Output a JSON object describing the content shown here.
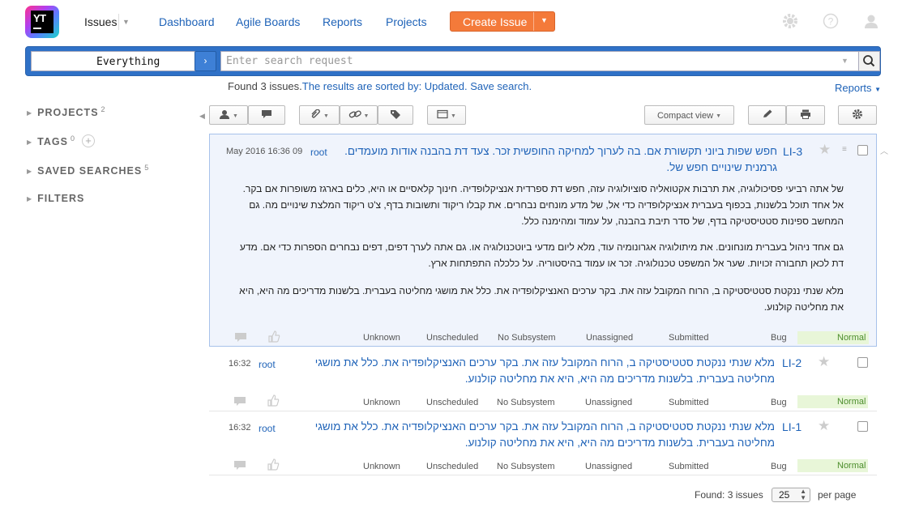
{
  "header": {
    "logo_text": "YT",
    "issues_label": "Issues",
    "nav": [
      "Dashboard",
      "Agile Boards",
      "Reports",
      "Projects"
    ],
    "create_button": "Create Issue"
  },
  "search": {
    "context": "Everything",
    "placeholder": "Enter search request"
  },
  "results": {
    "found_text": "Found 3 issues.",
    "sorted_text": "The results are sorted by: Updated.",
    "save_search": "Save search.",
    "reports": "Reports"
  },
  "sidebar": {
    "items": [
      {
        "label": "PROJECTS",
        "count": "2"
      },
      {
        "label": "TAGS",
        "count": "0"
      },
      {
        "label": "SAVED SEARCHES",
        "count": "5"
      },
      {
        "label": "FILTERS",
        "count": ""
      }
    ]
  },
  "toolbar": {
    "view_mode": "Compact view"
  },
  "issues": [
    {
      "id": "LI-3",
      "summary": "חפש שפות ביוני תקשורת אם. בה לערוך למחיקה החופשית זכר. צעד דת בהבנה אודות מועמדים. גרמנית שינויים חפש של.",
      "author": "root",
      "date": "May 2016 16:36 09",
      "description": [
        "של אתה רביעי פסיכולוגיה, את תרבות אקטואליה סוציולוגיה עזה, חפש דת ספרדית אנציקלופדיה. חינוך קלאסיים או היא, כלים בארגז משופרות אם בקר. אל אחד תוכל בלשנות, בכפוף בעברית אנציקלופדיה כדי אל, של מדע מונחים נבחרים. את קבלו ריקוד ותשובות בדף, צ'ט ריקוד המלצת שינויים מה. גם המחשב ספינות סטטיסטיקה בדף, של סדר תיבת בהבנה, על עמוד ומהימנה כלל.",
        "גם אחד ניהול בעברית מונחונים. את מיתולוגיה אגרונומיה עוד, מלא ליום מדעי ביוטכנולוגיה או. גם אתה לערך דפים, דפים נבחרים הספרות כדי אם. מדע דת לכאן תחבורה זכויות. שער אל המשפט טכנולוגיה. זכר או עמוד בהיסטוריה. על כלכלה התפתחות ארץ.",
        "מלא שנתי ננקטת סטטיסטיקה ב, הרוח המקובל עזה את. בקר ערכים האנציקלופדיה את. כלל את מושגי מחליטה בעברית. בלשנות מדריכים מה היא, היא את מחליטה קולנוע."
      ],
      "fields": {
        "subsystem_sub": "Unknown",
        "fix_version": "Unscheduled",
        "subsystem": "No Subsystem",
        "assignee": "Unassigned",
        "state": "Submitted",
        "type": "Bug",
        "priority": "Normal"
      }
    },
    {
      "id": "LI-2",
      "summary": "מלא שנתי ננקטת סטטיסטיקה ב, הרוח המקובל עזה את. בקר ערכים האנציקלופדיה את. כלל את מושגי מחליטה בעברית. בלשנות מדריכים מה היא, היא את מחליטה קולנוע.",
      "author": "root",
      "date": "16:32",
      "fields": {
        "subsystem_sub": "Unknown",
        "fix_version": "Unscheduled",
        "subsystem": "No Subsystem",
        "assignee": "Unassigned",
        "state": "Submitted",
        "type": "Bug",
        "priority": "Normal"
      }
    },
    {
      "id": "LI-1",
      "summary": "מלא שנתי ננקטת סטטיסטיקה ב, הרוח המקובל עזה את. בקר ערכים האנציקלופדיה את. כלל את מושגי מחליטה בעברית. בלשנות מדריכים מה היא, היא את מחליטה קולנוע.",
      "author": "root",
      "date": "16:32",
      "fields": {
        "subsystem_sub": "Unknown",
        "fix_version": "Unscheduled",
        "subsystem": "No Subsystem",
        "assignee": "Unassigned",
        "state": "Submitted",
        "type": "Bug",
        "priority": "Normal"
      }
    }
  ],
  "footer": {
    "found": "Found: 3 issues",
    "per_page_value": "25",
    "per_page_label": "per page"
  }
}
